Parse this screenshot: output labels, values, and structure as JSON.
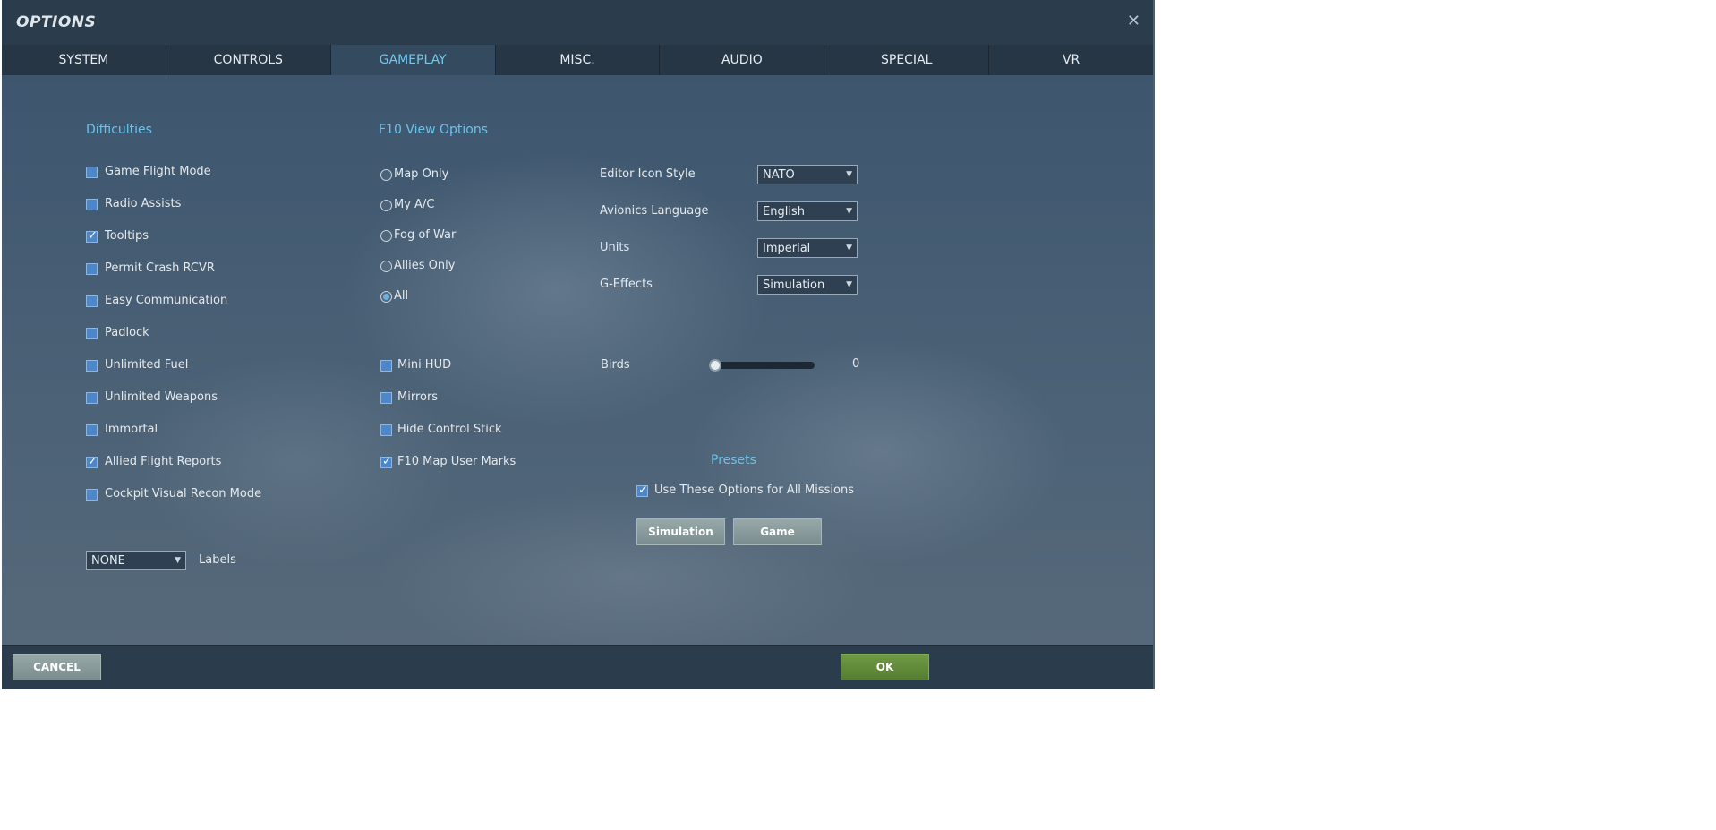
{
  "window": {
    "title": "OPTIONS",
    "close_glyph": "✕"
  },
  "tabs": [
    {
      "label": "SYSTEM"
    },
    {
      "label": "CONTROLS"
    },
    {
      "label": "GAMEPLAY"
    },
    {
      "label": "MISC."
    },
    {
      "label": "AUDIO"
    },
    {
      "label": "SPECIAL"
    },
    {
      "label": "VR"
    }
  ],
  "active_tab": "GAMEPLAY",
  "difficulties": {
    "title": "Difficulties",
    "items": [
      {
        "label": "Game Flight Mode",
        "checked": false
      },
      {
        "label": "Radio Assists",
        "checked": false
      },
      {
        "label": "Tooltips",
        "checked": true
      },
      {
        "label": "Permit Crash RCVR",
        "checked": false
      },
      {
        "label": "Easy Communication",
        "checked": false
      },
      {
        "label": "Padlock",
        "checked": false
      },
      {
        "label": "Unlimited Fuel",
        "checked": false
      },
      {
        "label": "Unlimited Weapons",
        "checked": false
      },
      {
        "label": "Immortal",
        "checked": false
      },
      {
        "label": "Allied Flight Reports",
        "checked": true
      },
      {
        "label": "Cockpit Visual Recon Mode",
        "checked": false
      }
    ]
  },
  "f10_view": {
    "title": "F10 View Options",
    "options": [
      {
        "label": "Map Only",
        "selected": false
      },
      {
        "label": "My A/C",
        "selected": false
      },
      {
        "label": "Fog of War",
        "selected": false
      },
      {
        "label": "Allies Only",
        "selected": false
      },
      {
        "label": "All",
        "selected": true
      }
    ]
  },
  "misc_checks": [
    {
      "label": "Mini HUD",
      "checked": false
    },
    {
      "label": "Mirrors",
      "checked": false
    },
    {
      "label": "Hide Control Stick",
      "checked": false
    },
    {
      "label": "F10 Map User Marks",
      "checked": true
    }
  ],
  "settings": [
    {
      "label": "Editor Icon Style",
      "value": "NATO"
    },
    {
      "label": "Avionics Language",
      "value": "English"
    },
    {
      "label": "Units",
      "value": "Imperial"
    },
    {
      "label": "G-Effects",
      "value": "Simulation"
    }
  ],
  "birds": {
    "label": "Birds",
    "value": "0",
    "fraction": 0.0
  },
  "labels": {
    "select_value": "NONE",
    "label": "Labels"
  },
  "presets": {
    "title": "Presets",
    "use_for_all_label": "Use These Options for All Missions",
    "use_for_all_checked": true,
    "simulation_label": "Simulation",
    "game_label": "Game"
  },
  "footer": {
    "cancel_label": "CANCEL",
    "ok_label": "OK"
  },
  "glyphs": {
    "check": "✓",
    "dropdown_arrow": "▼"
  },
  "colors": {
    "accent": "#69c2ea",
    "checkbox": "#4d86c9",
    "ok_button": "#5f8a3a",
    "panel": "#34475a"
  }
}
